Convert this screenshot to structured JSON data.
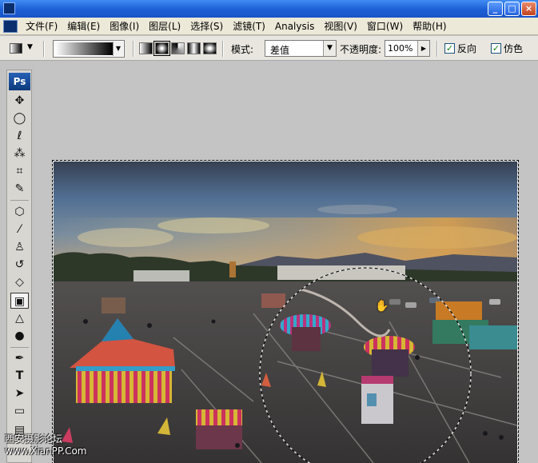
{
  "titlebar": {
    "title": "",
    "minimize": "_",
    "maximize": "□",
    "close": "×"
  },
  "menu": [
    "文件(F)",
    "编辑(E)",
    "图像(I)",
    "图层(L)",
    "选择(S)",
    "滤镜(T)",
    "Analysis",
    "视图(V)",
    "窗口(W)",
    "帮助(H)"
  ],
  "options": {
    "mode_label": "模式:",
    "mode_value": "差值",
    "opacity_label": "不透明度:",
    "opacity_value": "100%",
    "reverse_label": "反向",
    "dither_label": "仿色",
    "reverse_checked": true,
    "dither_checked": true
  },
  "toolbox": {
    "badge": "Ps"
  },
  "watermark": {
    "line1": "西安摄影论坛",
    "line2": "www.XianPP.Com"
  },
  "colors": {
    "title_bar": "#1c5fd6",
    "menu_bg": "#ece9d8",
    "workspace": "#c4c4c4",
    "check_green": "#1a7a1a"
  }
}
